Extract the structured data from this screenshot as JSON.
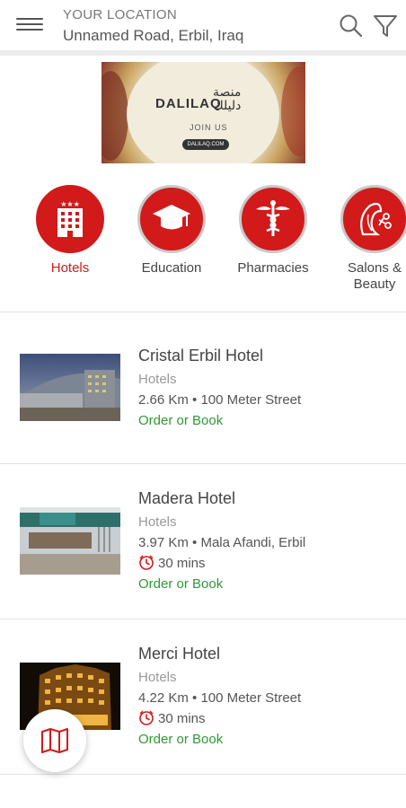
{
  "header": {
    "location_label": "YOUR LOCATION",
    "location_value": "Unnamed Road, Erbil, Iraq"
  },
  "banner": {
    "brand": "DALILAQ",
    "arabic_line1": "منصة",
    "arabic_line2": "دليلك",
    "cta": "JOIN US",
    "url": "DALILAQ.COM"
  },
  "categories": [
    {
      "label": "Hotels",
      "icon": "hotel-icon",
      "active": true
    },
    {
      "label": "Education",
      "icon": "graduation-cap-icon",
      "active": false
    },
    {
      "label": "Pharmacies",
      "icon": "caduceus-icon",
      "active": false
    },
    {
      "label": "Salons & Beauty",
      "icon": "salon-icon",
      "active": false
    }
  ],
  "listings": [
    {
      "name": "Cristal Erbil Hotel",
      "category": "Hotels",
      "distance": "2.66 Km • 100 Meter Street",
      "time": "",
      "action": "Order or Book"
    },
    {
      "name": "Madera Hotel",
      "category": "Hotels",
      "distance": "3.97 Km • Mala Afandi, Erbil",
      "time": "30 mins",
      "action": "Order or Book"
    },
    {
      "name": "Merci Hotel",
      "category": "Hotels",
      "distance": "4.22 Km • 100 Meter Street",
      "time": "30 mins",
      "action": "Order or Book"
    }
  ],
  "colors": {
    "brand_red": "#d21a1a",
    "action_green": "#2e9a35",
    "muted_text": "#999999"
  },
  "icons": {
    "menu": "hamburger-menu-icon",
    "search": "search-icon",
    "filter": "filter-funnel-icon",
    "map": "map-icon",
    "clock": "clock-icon"
  }
}
